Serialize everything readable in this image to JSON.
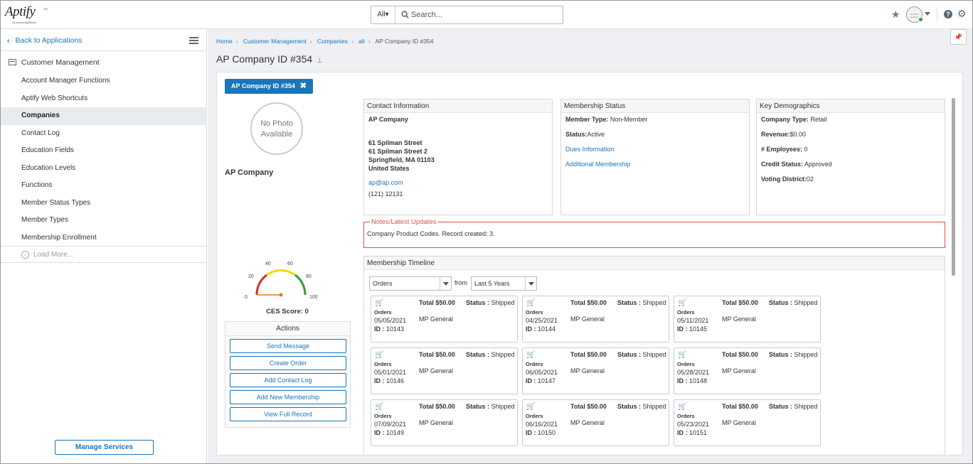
{
  "app": {
    "logo_text": "Aptify",
    "logo_tagline": "by communityBrands",
    "logo_tm": "TM"
  },
  "search": {
    "scope": "All",
    "placeholder": "Search..."
  },
  "header": {
    "avatar_text": "No Photo Available"
  },
  "sidebar": {
    "back_label": "Back to Applications",
    "module_label": "Customer Management",
    "items": [
      {
        "label": "Account Manager Functions",
        "active": false
      },
      {
        "label": "Aptify Web Shortcuts",
        "active": false
      },
      {
        "label": "Companies",
        "active": true
      },
      {
        "label": "Contact Log",
        "active": false
      },
      {
        "label": "Education Fields",
        "active": false
      },
      {
        "label": "Education Levels",
        "active": false
      },
      {
        "label": "Functions",
        "active": false
      },
      {
        "label": "Member Status Types",
        "active": false
      },
      {
        "label": "Member Types",
        "active": false
      },
      {
        "label": "Membership Enrollment",
        "active": false
      }
    ],
    "load_more": "Load More...",
    "manage_services": "Manage Services"
  },
  "breadcrumb": {
    "items": [
      "Home",
      "Customer Management",
      "Companies",
      "all"
    ],
    "current": "AP Company ID #354"
  },
  "page": {
    "title": "AP Company ID #354"
  },
  "record": {
    "tab_label": "AP Company ID #354",
    "photo_text_1": "No Photo",
    "photo_text_2": "Available",
    "company_name": "AP Company",
    "gauge": {
      "ticks": [
        "0",
        "20",
        "40",
        "60",
        "80",
        "100"
      ],
      "value": 0
    },
    "ces_label": "CES Score: 0"
  },
  "actions": {
    "title": "Actions",
    "buttons": [
      "Send Message",
      "Create Order",
      "Add Contact Log",
      "Add New Membership",
      "View Full Record"
    ]
  },
  "contact": {
    "title": "Contact Information",
    "name": "AP Company",
    "address": [
      "61 Spilman Street",
      "61 Spilman Street 2",
      "Springfield, MA 01103",
      "United States"
    ],
    "email": "ap@ap.com",
    "phone": "(121) 12131"
  },
  "membership": {
    "title": "Membership Status",
    "member_type_label": "Member Type:",
    "member_type": "Non-Member",
    "status_label": "Status:",
    "status": "Active",
    "dues_link": "Dues Information",
    "additional_link": "Additional Membership"
  },
  "demographics": {
    "title": "Key Demographics",
    "company_type_label": "Company Type:",
    "company_type": "Retail",
    "revenue_label": "Revenue:",
    "revenue": "$0.00",
    "employees_label": "# Employees:",
    "employees": "0",
    "credit_label": "Credit Status:",
    "credit": "Approved",
    "voting_label": "Voting District:",
    "voting": "02"
  },
  "notes": {
    "title": "Notes/Latest Updates",
    "text": "Company Product Codes. Record created: 3."
  },
  "timeline": {
    "title": "Membership Timeline",
    "type_select": "Orders",
    "from_label": "from",
    "range_select": "Last 5 Years",
    "orders": [
      {
        "type": "Orders",
        "date": "05/05/2021",
        "id_label": "ID :",
        "id": "10143",
        "total": "Total $50.00",
        "status_label": "Status :",
        "status": "Shipped",
        "product": "MP General"
      },
      {
        "type": "Orders",
        "date": "04/25/2021",
        "id_label": "ID :",
        "id": "10144",
        "total": "Total $50.00",
        "status_label": "Status :",
        "status": "Shipped",
        "product": "MP General"
      },
      {
        "type": "Orders",
        "date": "05/11/2021",
        "id_label": "ID :",
        "id": "10145",
        "total": "Total $50.00",
        "status_label": "Status :",
        "status": "Shipped",
        "product": "MP General"
      },
      {
        "type": "Orders",
        "date": "05/01/2021",
        "id_label": "ID :",
        "id": "10146",
        "total": "Total $50.00",
        "status_label": "Status :",
        "status": "Shipped",
        "product": "MP General"
      },
      {
        "type": "Orders",
        "date": "06/05/2021",
        "id_label": "ID :",
        "id": "10147",
        "total": "Total $50.00",
        "status_label": "Status :",
        "status": "Shipped",
        "product": "MP General"
      },
      {
        "type": "Orders",
        "date": "05/28/2021",
        "id_label": "ID :",
        "id": "10148",
        "total": "Total $50.00",
        "status_label": "Status :",
        "status": "Shipped",
        "product": "MP General"
      },
      {
        "type": "Orders",
        "date": "07/09/2021",
        "id_label": "ID :",
        "id": "10149",
        "total": "Total $50.00",
        "status_label": "Status :",
        "status": "Shipped",
        "product": "MP General"
      },
      {
        "type": "Orders",
        "date": "06/16/2021",
        "id_label": "ID :",
        "id": "10150",
        "total": "Total $50.00",
        "status_label": "Status :",
        "status": "Shipped",
        "product": "MP General"
      },
      {
        "type": "Orders",
        "date": "05/23/2021",
        "id_label": "ID :",
        "id": "10151",
        "total": "Total $50.00",
        "status_label": "Status :",
        "status": "Shipped",
        "product": "MP General"
      }
    ]
  },
  "colors": {
    "accent": "#1a75bb",
    "notes_border": "#d9534f",
    "active_nav": "#e8ebef",
    "gauge_red": "#d32f2f",
    "gauge_yellow": "#f2d80a",
    "gauge_green": "#2e9e3a",
    "needle": "#e07b1a"
  }
}
